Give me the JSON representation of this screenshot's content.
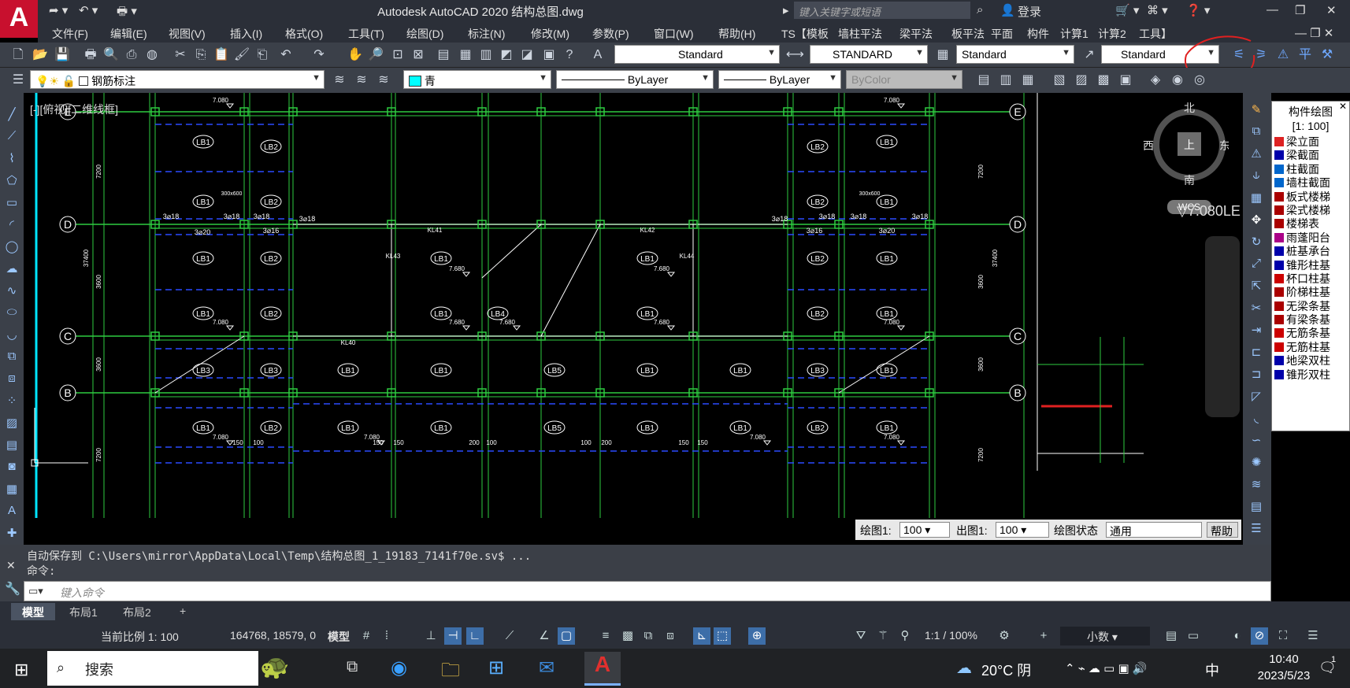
{
  "window": {
    "title": "Autodesk AutoCAD 2020    结构总图.dwg",
    "search_placeholder": "键入关键字或短语",
    "login": "登录"
  },
  "menu": [
    "文件(F)",
    "编辑(E)",
    "视图(V)",
    "插入(I)",
    "格式(O)",
    "工具(T)",
    "绘图(D)",
    "标注(N)",
    "修改(M)",
    "参数(P)",
    "窗口(W)",
    "帮助(H)",
    "TS【模板",
    "墙柱平法",
    "梁平法",
    "板平法",
    "平面",
    "构件",
    "计算1",
    "计算2",
    "工具】"
  ],
  "toolbar": {
    "text_style": "Standard",
    "dim_style": "STANDARD",
    "table_style": "Standard",
    "mleader_style": "Standard"
  },
  "properties": {
    "layer": "钢筋标注",
    "color": "青",
    "linetype": "ByLayer",
    "lineweight": "ByLayer",
    "plotstyle": "ByColor",
    "color_hex": "#00ffff"
  },
  "viewport": {
    "label": "[-][俯视][二维线框]",
    "compass": {
      "n": "北",
      "s": "南",
      "e": "东",
      "w": "西",
      "top": "上",
      "wcs": "WCS"
    },
    "elevation_label": "▽7.080LE"
  },
  "drawing": {
    "axes_left": [
      "E",
      "D",
      "C",
      "B"
    ],
    "axes_right": [
      "E",
      "D",
      "C",
      "B"
    ],
    "slabs": [
      {
        "label": "LB1"
      },
      {
        "label": "LB2"
      },
      {
        "label": "LB3"
      },
      {
        "label": "LB4"
      },
      {
        "label": "LB5"
      }
    ],
    "beams": [
      "KL41",
      "KL42",
      "KL40",
      "KL43",
      "KL44"
    ],
    "rebar": [
      "3⌀18",
      "3⌀20",
      "3⌀16"
    ],
    "dims": [
      "7200",
      "3600",
      "7200",
      "37400"
    ],
    "elev": [
      "7.080",
      "7.680"
    ],
    "small": [
      "150",
      "100",
      "200",
      "300x600"
    ]
  },
  "component_panel": {
    "title": "构件绘图",
    "scale": "[1: 100]",
    "items": [
      "梁立面",
      "梁截面",
      "柱截面",
      "墙柱截面",
      "板式楼梯",
      "梁式楼梯",
      "楼梯表",
      "雨蓬阳台",
      "桩基承台",
      "锥形柱基",
      "杯口柱基",
      "阶梯柱基",
      "无梁条基",
      "有梁条基",
      "无筋条基",
      "无筋柱基",
      "地梁双柱",
      "锥形双柱"
    ]
  },
  "scale_bar": {
    "draw_label": "绘图1:",
    "draw_value": "100",
    "out_label": "出图1:",
    "out_value": "100",
    "state_label": "绘图状态",
    "state_value": "通用",
    "help": "帮助"
  },
  "command": {
    "history_line1": "自动保存到 C:\\Users\\mirror\\AppData\\Local\\Temp\\结构总图_1_19183_7141f70e.sv$ ...",
    "history_line2": "命令:",
    "placeholder": "键入命令"
  },
  "tabs": [
    "模型",
    "布局1",
    "布局2"
  ],
  "status": {
    "scale": "当前比例 1: 100",
    "coords": "164768, 18579, 0",
    "model": "模型",
    "anno_scale": "1:1 / 100%",
    "units": "小数"
  },
  "taskbar": {
    "search": "搜索",
    "weather": "20°C 阴",
    "ime": "中",
    "time": "10:40",
    "date": "2023/5/23",
    "notif": "1"
  }
}
